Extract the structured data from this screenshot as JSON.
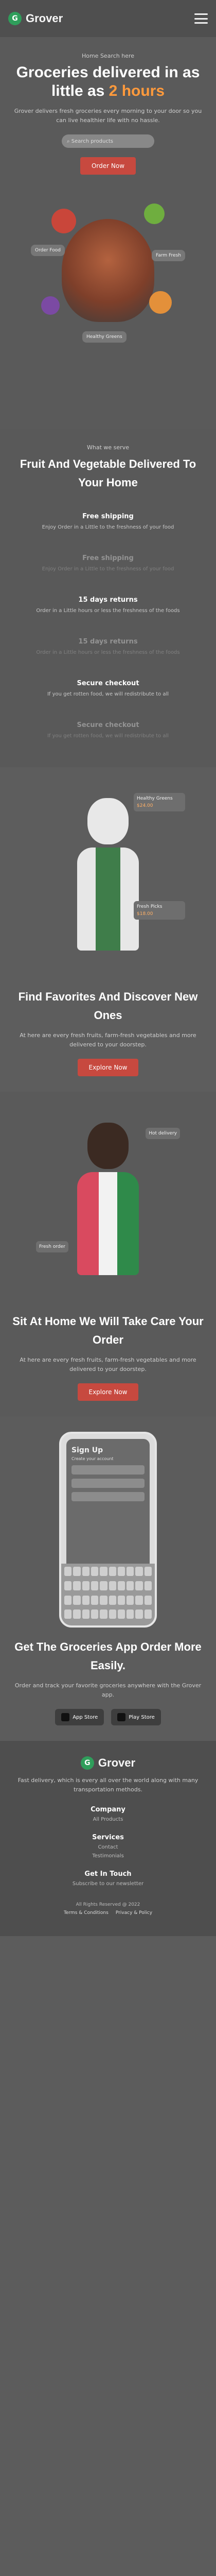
{
  "brand": {
    "logo_letter": "G",
    "name": "Grover"
  },
  "hero": {
    "eyebrow": "Home  Search here",
    "title_a": "Groceries delivered in as little as",
    "title_accent": "2 hours",
    "text": "Grover delivers fresh groceries every morning to your door so you can live healthier life with no hassle.",
    "cta": "Order Now",
    "search_placeholder": "Search products",
    "chip_1": "Order Food",
    "chip_2": "Farm Fresh",
    "chip_3": "Healthy Greens"
  },
  "fresh": {
    "eyebrow": "What we serve",
    "title": "Fruit And Vegetable Delivered To Your Home",
    "features": [
      {
        "title": "Free shipping",
        "text": "Enjoy Order in a Little to the freshness of your food"
      },
      {
        "title": "Free shipping",
        "text": "Enjoy Order in a Little to the freshness of your food"
      },
      {
        "title": "15 days returns",
        "text": "Order in a Little hours or less the freshness of the foods"
      },
      {
        "title": "15 days returns",
        "text": "Order in a Little hours or less the freshness of the foods"
      },
      {
        "title": "Secure checkout",
        "text": "If you get rotten food, we will redistribute to all"
      },
      {
        "title": "Secure checkout",
        "text": "If you get rotten food, we will redistribute to all"
      }
    ]
  },
  "favorites": {
    "title": "Find Favorites And Discover New Ones",
    "text": "At here are every fresh fruits, farm-fresh vegetables and more delivered to your doorstep.",
    "cta": "Explore Now",
    "card_title": "Healthy Greens",
    "card_price": "$24.00",
    "card_title_2": "Fresh Picks",
    "card_price_2": "$18.00"
  },
  "home": {
    "title": "Sit At Home We Will Take Care Your Order",
    "text": "At here are every fresh fruits, farm-fresh vegetables and more delivered to your doorstep.",
    "cta": "Explore Now",
    "tag_1": "Hot delivery",
    "tag_2": "Fresh order"
  },
  "app": {
    "phone_title": "Sign Up",
    "phone_sub": "Create your account",
    "title": "Get The Groceries App Order More Easily.",
    "text": "Order and track your favorite groceries anywhere with the Grover app.",
    "store_1": "App Store",
    "store_2": "Play Store"
  },
  "footer": {
    "tagline": "Fast delivery, which is every all over the world along with many transportation methods.",
    "cols": [
      {
        "heading": "Company",
        "links": [
          "All Products"
        ]
      },
      {
        "heading": "Services",
        "links": [
          "Contact",
          "Testimonials"
        ]
      },
      {
        "heading": "Get In Touch",
        "links": [
          "Subscribe to our newsletter"
        ]
      }
    ],
    "copyright": "All Rights Reserved @ 2022",
    "terms": "Terms & Conditions",
    "privacy": "Privacy & Policy"
  }
}
